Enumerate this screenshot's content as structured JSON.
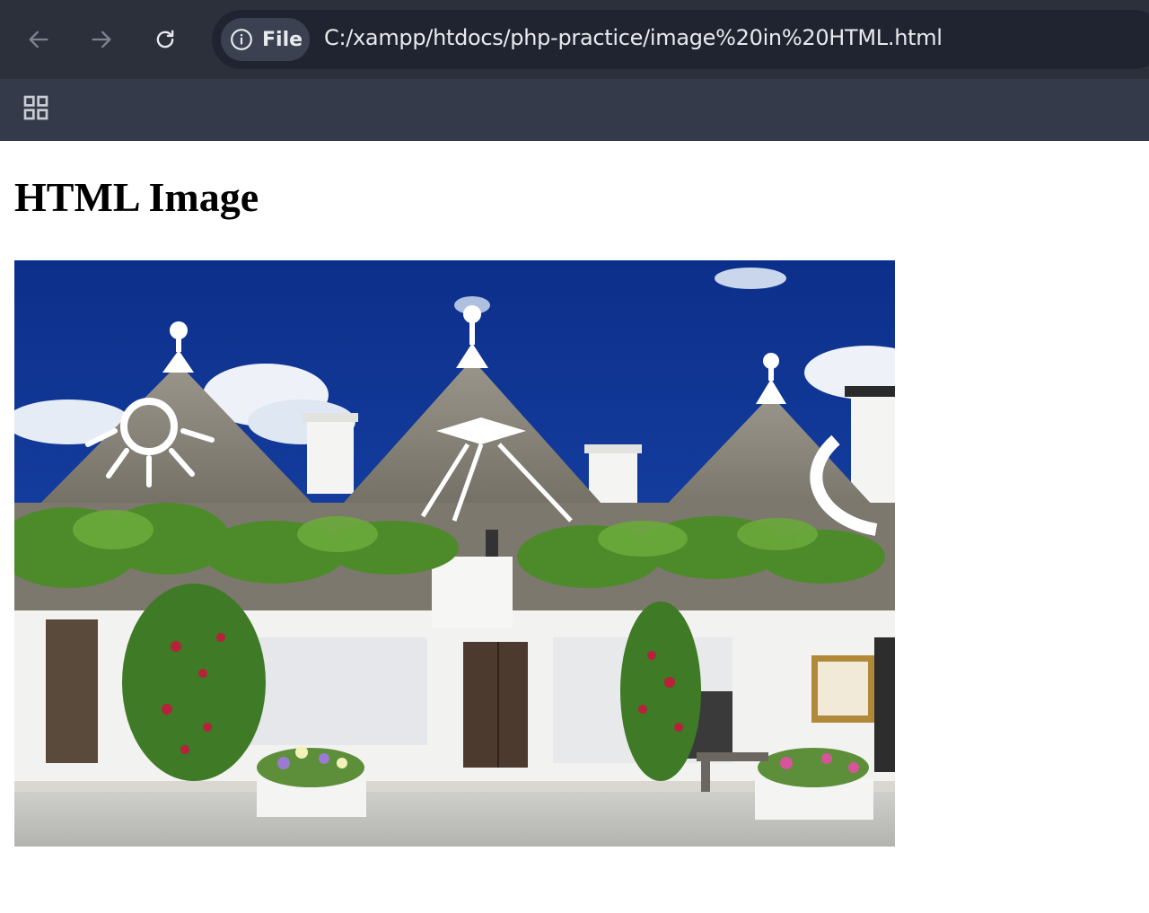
{
  "browser": {
    "back_icon": "arrow-left-icon",
    "forward_icon": "arrow-right-icon",
    "reload_icon": "reload-icon",
    "site_info_icon": "info-icon",
    "site_chip_label": "File",
    "url": "C:/xampp/htdocs/php-practice/image%20in%20HTML.html",
    "apps_icon": "apps-grid-icon",
    "colors": {
      "toolbar": "#2b303b",
      "omnibox": "#1f2430",
      "bookmarks_bar": "#343a49"
    }
  },
  "page": {
    "heading": "HTML Image",
    "image": {
      "subject": "photo-of-trulli-houses"
    }
  }
}
